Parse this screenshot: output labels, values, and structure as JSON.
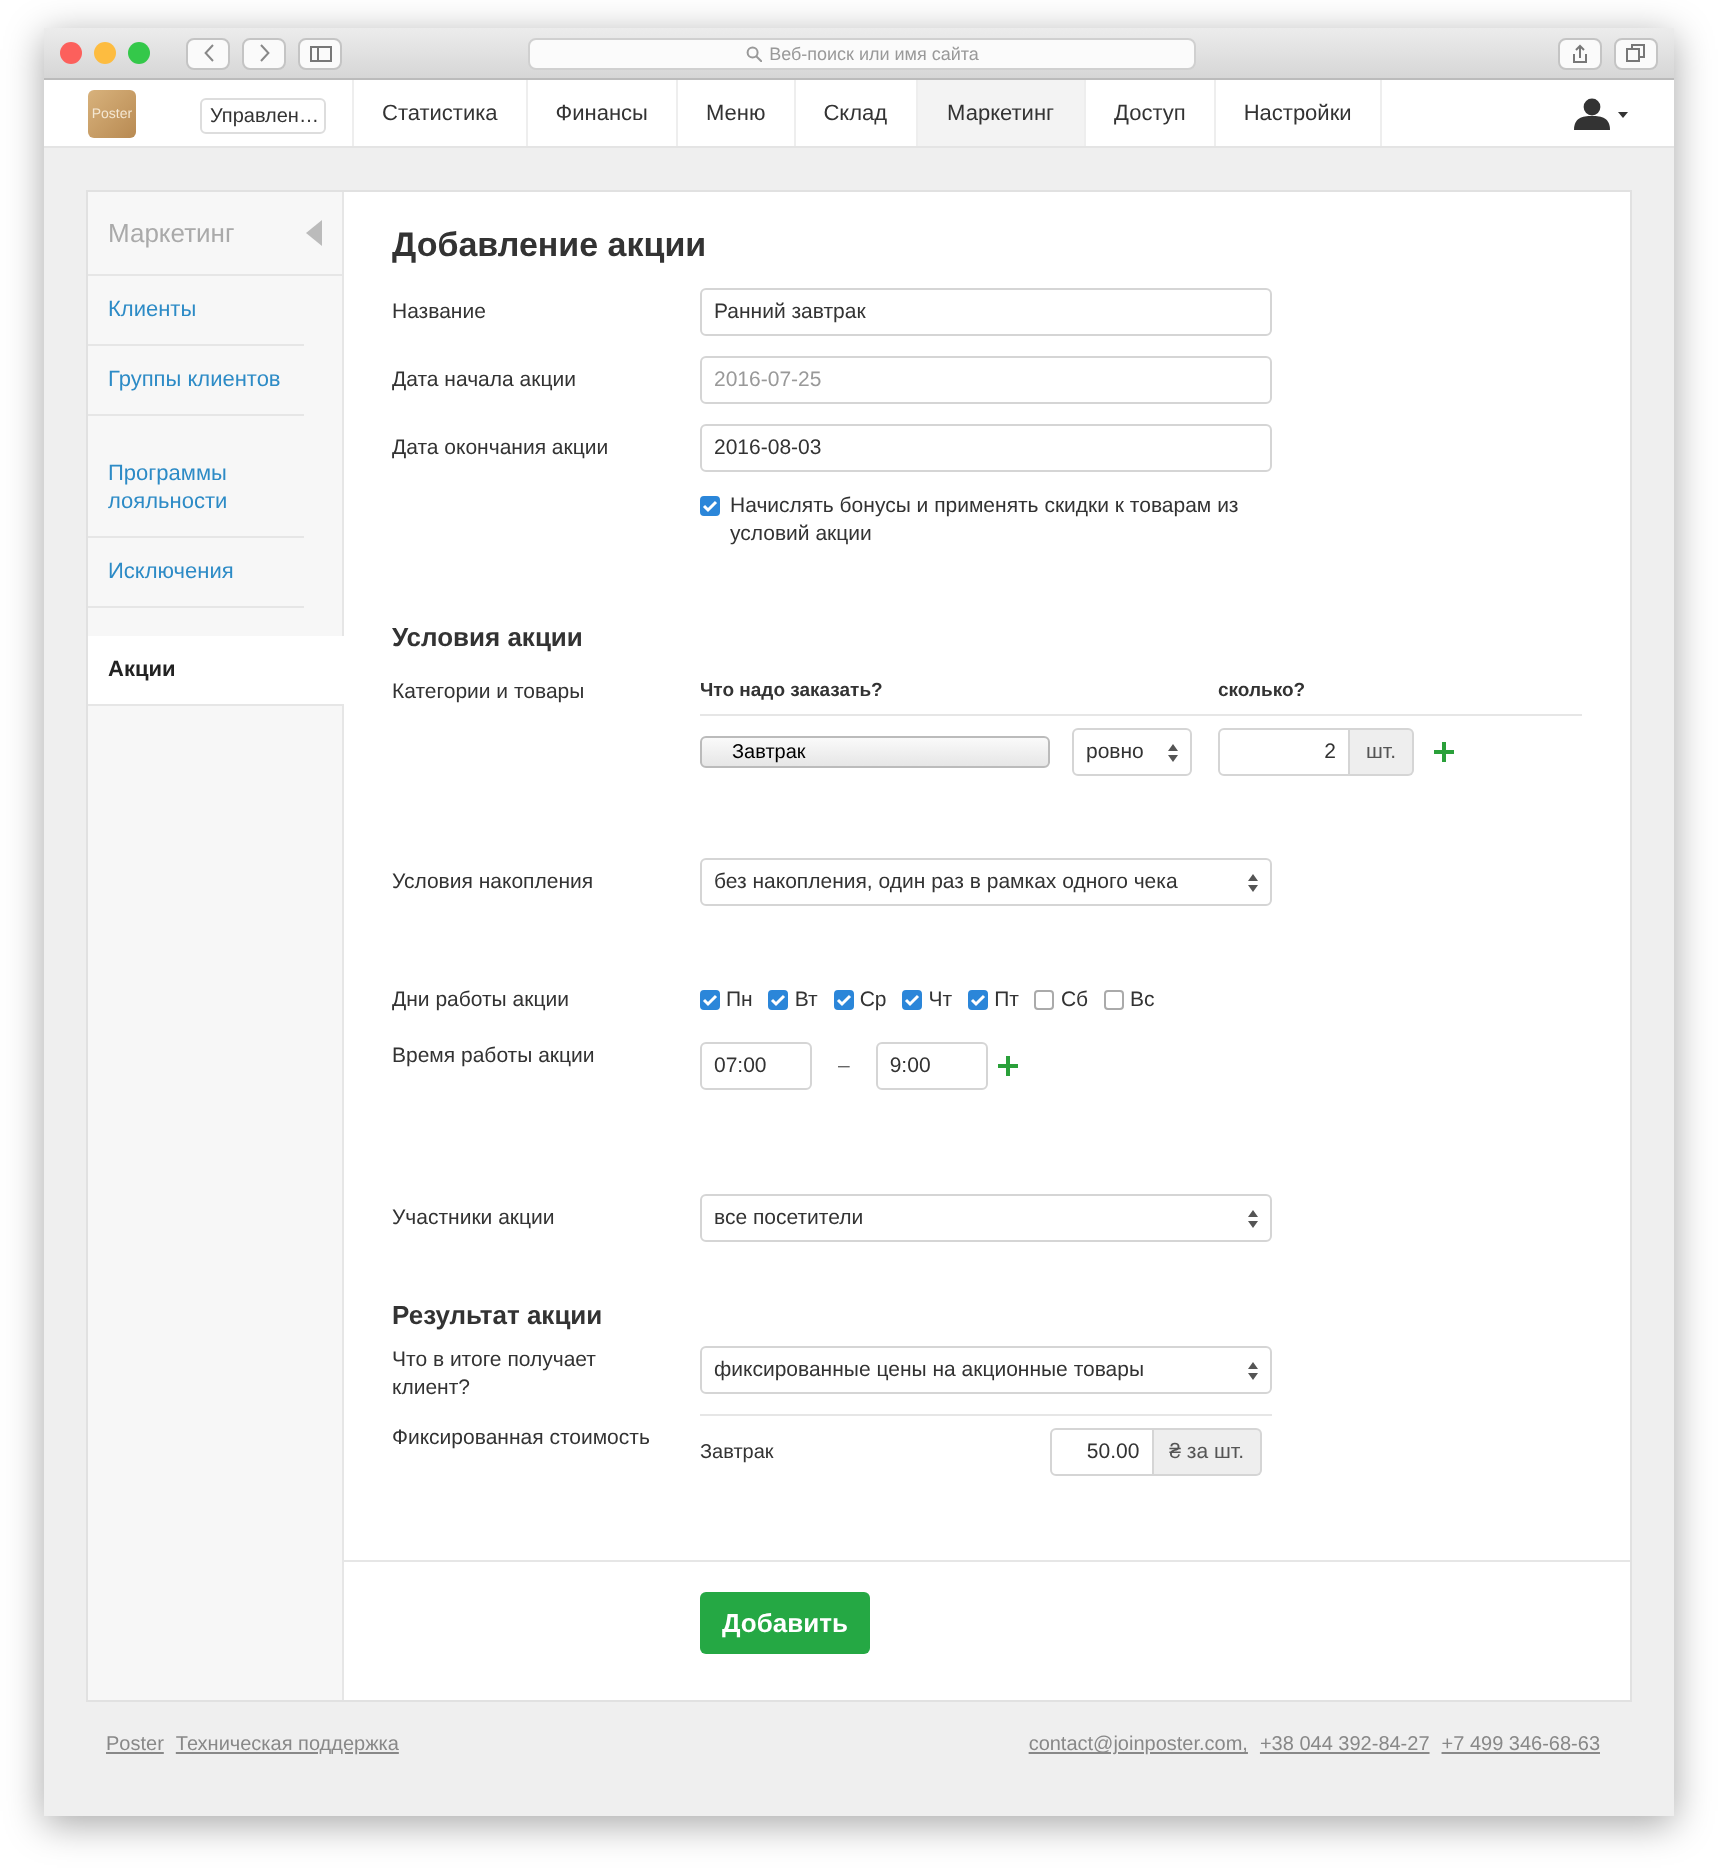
{
  "browser": {
    "address_placeholder": "Веб-поиск или имя сайта"
  },
  "nav": {
    "logo": "Poster",
    "account_select": "Управлен…",
    "items": [
      {
        "label": "Статистика",
        "selected": false
      },
      {
        "label": "Финансы",
        "selected": false
      },
      {
        "label": "Меню",
        "selected": false
      },
      {
        "label": "Склад",
        "selected": false
      },
      {
        "label": "Маркетинг",
        "selected": true
      },
      {
        "label": "Доступ",
        "selected": false
      },
      {
        "label": "Настройки",
        "selected": false
      }
    ]
  },
  "sidebar": {
    "title": "Маркетинг",
    "groups": [
      [
        {
          "label": "Клиенты",
          "selected": false
        },
        {
          "label": "Группы клиентов",
          "selected": false
        }
      ],
      [
        {
          "label": "Программы лояльности",
          "selected": false
        },
        {
          "label": "Исключения",
          "selected": false
        }
      ],
      [
        {
          "label": "Акции",
          "selected": true
        }
      ]
    ]
  },
  "form": {
    "title": "Добавление акции",
    "fields": [
      {
        "label": "Название",
        "value": "Ранний завтрак"
      },
      {
        "label": "Дата начала акции",
        "placeholder": "2016-07-25"
      },
      {
        "label": "Дата окончания акции",
        "value": "2016-08-03"
      }
    ],
    "bonus_checkbox": {
      "label": "Начислять бонусы и применять скидки к товарам из условий акции",
      "checked": true
    },
    "conditions": {
      "title": "Условия акции",
      "label": "Категории и товары",
      "col_what": "Что надо заказать?",
      "col_qty": "сколько?",
      "product": "Завтрак",
      "operator": "ровно",
      "quantity": "2",
      "unit": "шт.",
      "accumulation_label": "Условия накопления",
      "accumulation": "без накопления, один раз в рамках одного чека",
      "days_label": "Дни работы акции",
      "days": [
        {
          "label": "Пн",
          "checked": true
        },
        {
          "label": "Вт",
          "checked": true
        },
        {
          "label": "Ср",
          "checked": true
        },
        {
          "label": "Чт",
          "checked": true
        },
        {
          "label": "Пт",
          "checked": true
        },
        {
          "label": "Сб",
          "checked": false
        },
        {
          "label": "Вс",
          "checked": false
        }
      ],
      "time_label": "Время работы акции",
      "time_from": "07:00",
      "time_dash": "–",
      "time_to": "9:00",
      "participants_label": "Участники акции",
      "participants": "все посетители"
    },
    "result": {
      "title": "Результат акции",
      "client_label": "Что в итоге получает клиент?",
      "client_value": "фиксированные цены на акционные товары",
      "price_label": "Фиксированная стоимость",
      "product": "Завтрак",
      "price": "50.00",
      "unit": "₴ за шт."
    },
    "submit": "Добавить"
  },
  "footer": {
    "left": [
      "Poster",
      "Техническая поддержка"
    ],
    "right": [
      "contact@joinposter.com,",
      "+38 044 392-84-27",
      "+7 499 346-68-63"
    ]
  }
}
